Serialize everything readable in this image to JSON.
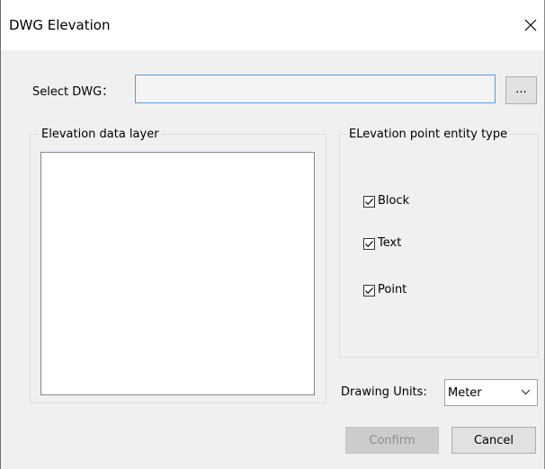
{
  "window": {
    "title": "DWG Elevation",
    "close_icon": "close-icon"
  },
  "select_dwg": {
    "label": "Select DWG：",
    "value": "",
    "browse_label": "..."
  },
  "elevation_layer": {
    "title": "Elevation data layer",
    "items": []
  },
  "entity_type": {
    "title": "ELevation point entity type",
    "options": [
      {
        "label": "Block",
        "checked": true
      },
      {
        "label": "Text",
        "checked": true
      },
      {
        "label": "Point",
        "checked": true
      }
    ]
  },
  "units": {
    "label": "Drawing Units:",
    "selected": "Meter",
    "icon": "chevron-down-icon"
  },
  "buttons": {
    "confirm": "Confirm",
    "confirm_enabled": false,
    "cancel": "Cancel"
  },
  "colors": {
    "input_focus_border": "#5b9bd5",
    "disabled_button_bg": "#cccccc"
  }
}
